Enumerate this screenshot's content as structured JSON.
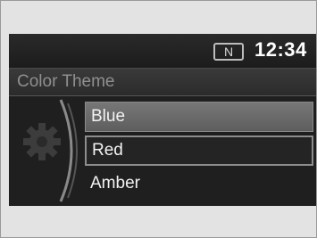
{
  "status": {
    "gear": "N",
    "clock": "12:34"
  },
  "menu": {
    "title": "Color Theme",
    "items": [
      {
        "label": "Blue",
        "state": "highlighted"
      },
      {
        "label": "Red",
        "state": "selected"
      },
      {
        "label": "Amber",
        "state": "normal"
      }
    ]
  },
  "icons": {
    "settings": "gear-icon",
    "scroll_indicator": "bracket-icon"
  },
  "colors": {
    "screen_bg": "#1f1f1f",
    "highlight": "#6a6a6a",
    "text": "#f2f2f2",
    "title_text": "#8f8f8f"
  }
}
